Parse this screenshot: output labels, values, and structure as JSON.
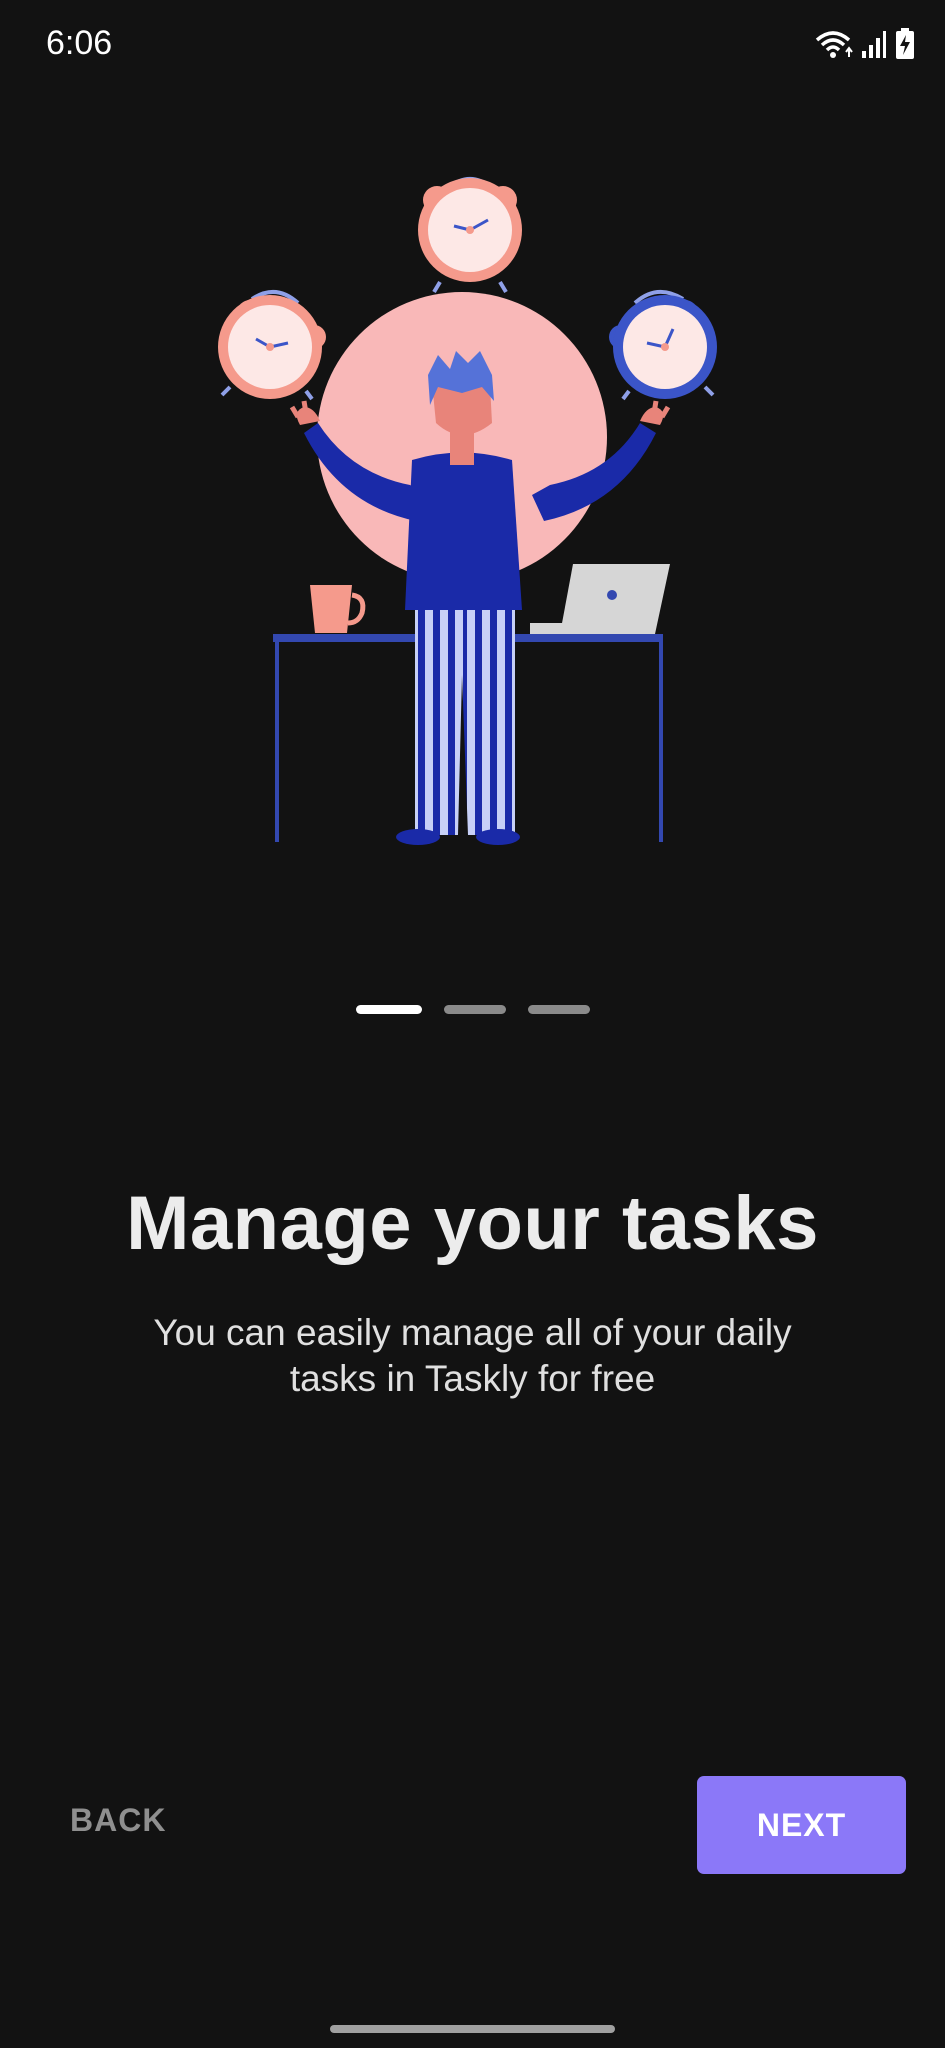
{
  "status_bar": {
    "time": "6:06",
    "icons": [
      "wifi-icon",
      "signal-icon",
      "battery-charging-icon"
    ]
  },
  "illustration": {
    "name": "person-juggling-alarm-clocks",
    "colors": {
      "circle": "#f9b8b8",
      "shirt": "#1a2aa8",
      "pink_clock": "#f59a8c",
      "blue_clock": "#3b55c8",
      "desk": "#3348b0"
    }
  },
  "pager": {
    "total": 3,
    "active": 0
  },
  "onboarding": {
    "title": "Manage your tasks",
    "subtitle": "You can easily manage all of your daily tasks in Taskly for free"
  },
  "buttons": {
    "back": "BACK",
    "next": "NEXT"
  },
  "colors": {
    "background": "#121212",
    "accent": "#8b78f8"
  }
}
